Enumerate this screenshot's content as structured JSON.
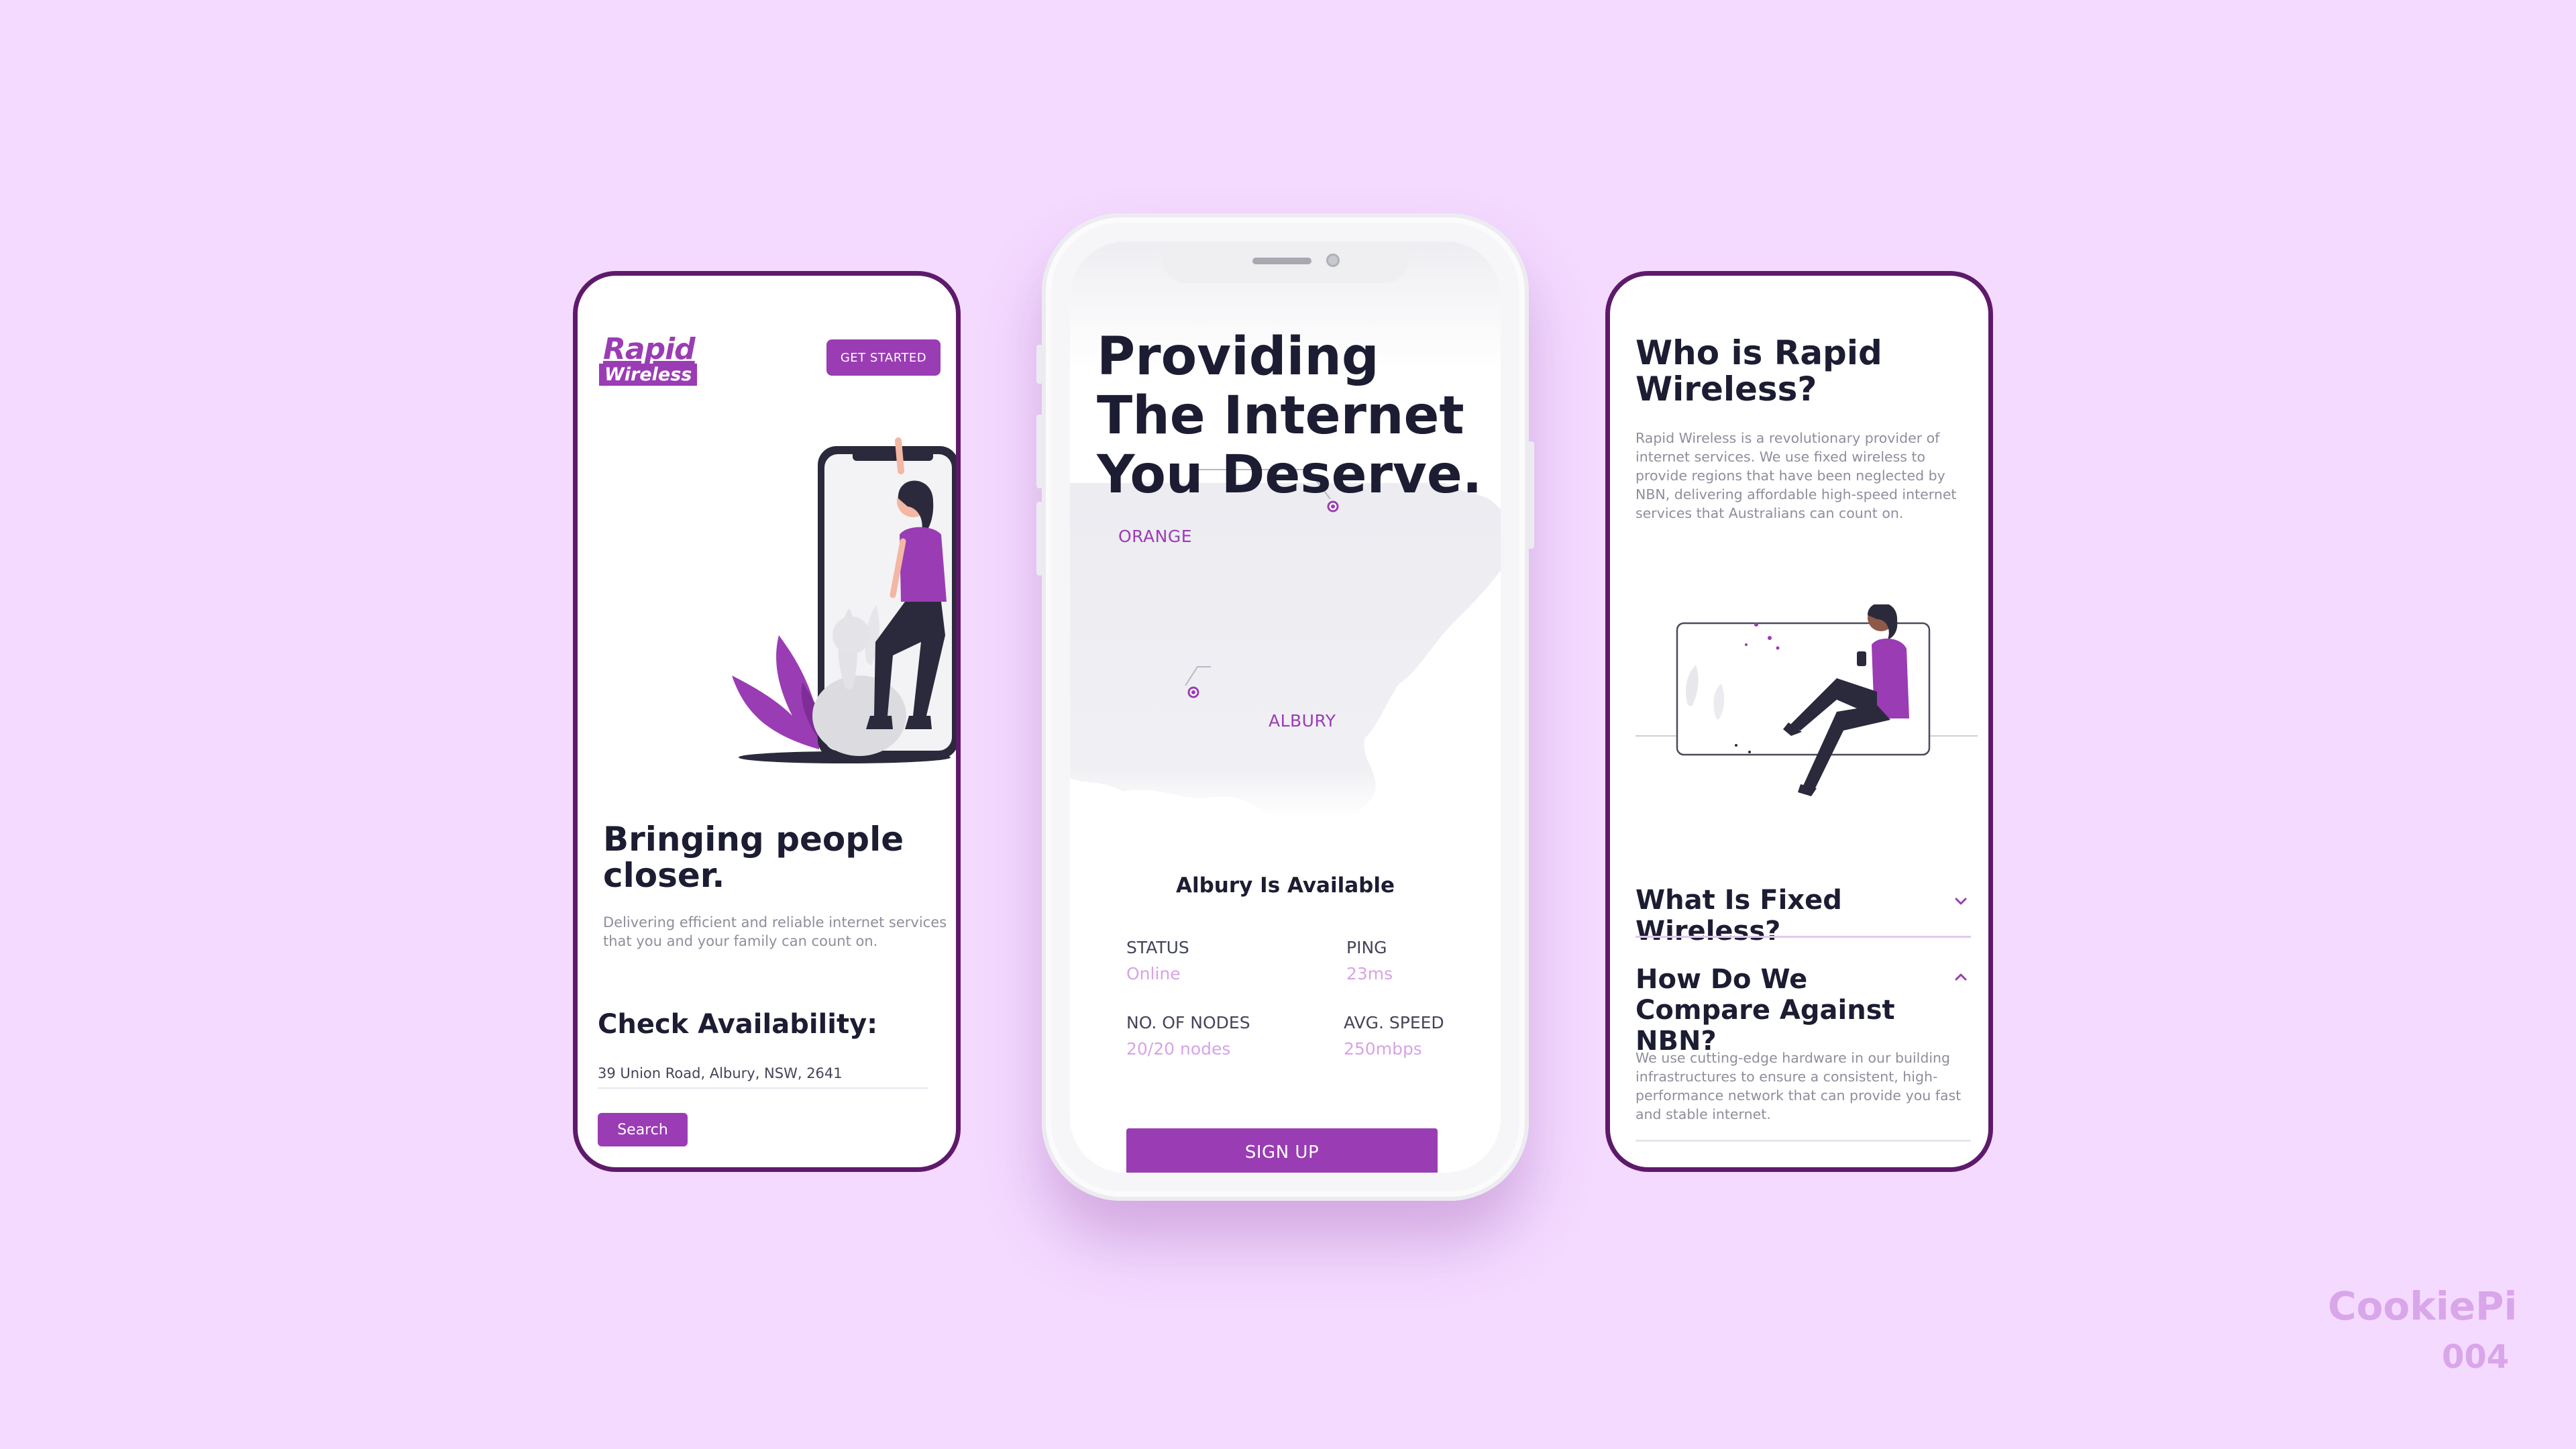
{
  "left_phone": {
    "logo": {
      "line1": "Rapid",
      "line2": "Wireless"
    },
    "get_started_label": "GET STARTED",
    "hero_title": "Bringing people closer.",
    "hero_subtitle": "Delivering efficient and reliable internet services that you and your family can count on.",
    "check_title": "Check Availability:",
    "address_value": "39 Union Road, Albury, NSW, 2641",
    "search_label": "Search"
  },
  "middle_phone": {
    "headline": "Providing The Internet You Deserve.",
    "map_labels": {
      "orange": "ORANGE",
      "albury": "ALBURY"
    },
    "availability_title": "Albury Is Available",
    "stats": {
      "status_label": "STATUS",
      "status_value": "Online",
      "ping_label": "PING",
      "ping_value": "23ms",
      "nodes_label": "NO. OF NODES",
      "nodes_value": "20/20 nodes",
      "speed_label": "AVG. SPEED",
      "speed_value": "250mbps"
    },
    "signup_label": "SIGN UP"
  },
  "right_phone": {
    "who_title": "Who is Rapid Wireless?",
    "who_body": "Rapid Wireless is a revolutionary provider of internet services. We use fixed wireless to provide regions that have been neglected by NBN, delivering affordable high-speed internet services that Australians can count on.",
    "faq": [
      {
        "question": "What Is Fixed Wireless?",
        "icon": "chevron-down-icon"
      },
      {
        "question": "How Do We Compare Against NBN?",
        "icon": "chevron-up-icon",
        "answer": "We use cutting-edge hardware in our building infrastructures to ensure a consistent, high-performance network that can provide you fast and stable internet."
      }
    ]
  },
  "watermark": {
    "brand": "CookiePi",
    "number": "004"
  },
  "colors": {
    "background": "#f4daff",
    "accent": "#9a3cb4",
    "frame": "#5e1a6a",
    "text": "#1c1c33",
    "muted": "#8e8e9c"
  }
}
